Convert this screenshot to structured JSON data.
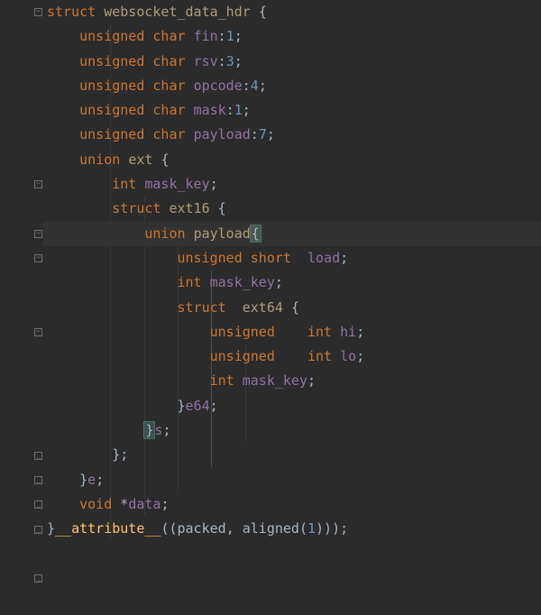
{
  "keywords": {
    "struct": "struct",
    "unsigned": "unsigned",
    "char": "char",
    "union": "union",
    "int": "int",
    "short": "short",
    "void": "void"
  },
  "types": {
    "websocket_data_hdr": "websocket_data_hdr",
    "ext": "ext",
    "ext16": "ext16",
    "payload": "payload",
    "ext64": "ext64"
  },
  "fields": {
    "fin": "fin",
    "rsv": "rsv",
    "opcode": "opcode",
    "mask": "mask",
    "payload": "payload",
    "mask_key": "mask_key",
    "load": "load",
    "hi": "hi",
    "lo": "lo",
    "e64": "e64",
    "s": "s",
    "e": "e",
    "data": "data"
  },
  "nums": {
    "n1": "1",
    "n3": "3",
    "n4": "4",
    "n7": "7"
  },
  "attr": {
    "attribute": "__attribute__",
    "packed": "packed",
    "aligned": "aligned"
  }
}
